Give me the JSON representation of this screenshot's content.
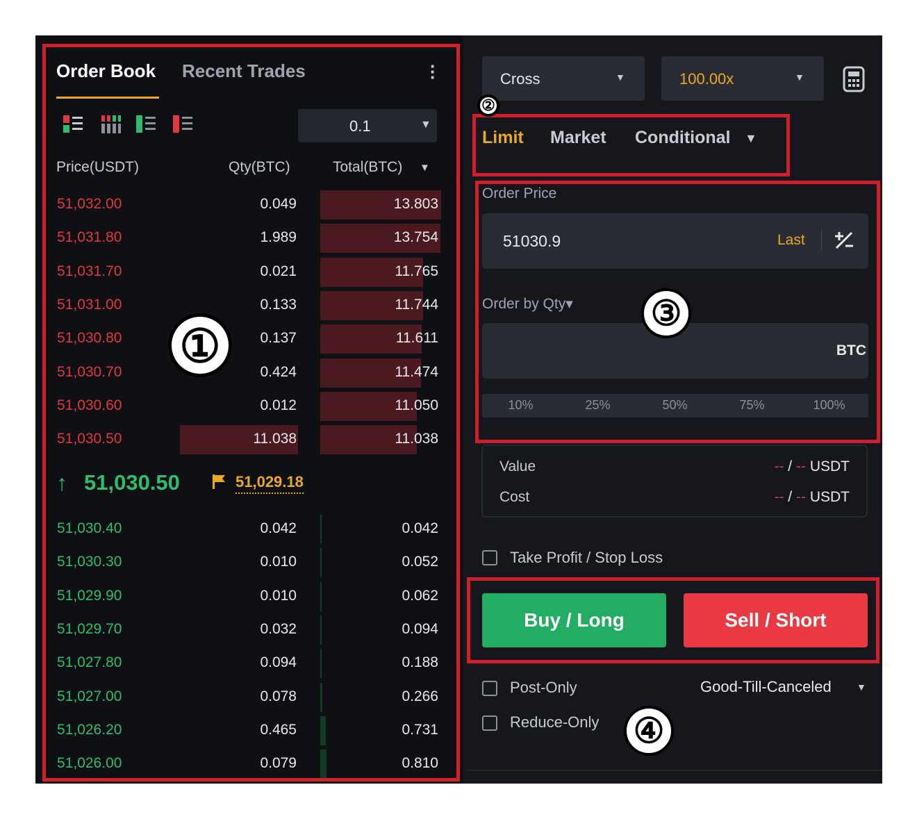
{
  "orderbook": {
    "tabs": [
      "Order Book",
      "Recent Trades"
    ],
    "precision": "0.1",
    "columns": {
      "price": "Price(USDT)",
      "qty": "Qty(BTC)",
      "total": "Total(BTC)"
    },
    "asks": [
      {
        "price": "51,032.00",
        "qty": "0.049",
        "total": "13.803"
      },
      {
        "price": "51,031.80",
        "qty": "1.989",
        "total": "13.754"
      },
      {
        "price": "51,031.70",
        "qty": "0.021",
        "total": "11.765"
      },
      {
        "price": "51,031.00",
        "qty": "0.133",
        "total": "11.744"
      },
      {
        "price": "51,030.80",
        "qty": "0.137",
        "total": "11.611"
      },
      {
        "price": "51,030.70",
        "qty": "0.424",
        "total": "11.474"
      },
      {
        "price": "51,030.60",
        "qty": "0.012",
        "total": "11.050"
      },
      {
        "price": "51,030.50",
        "qty": "11.038",
        "total": "11.038"
      }
    ],
    "last_price": "51,030.50",
    "mark_price": "51,029.18",
    "bids": [
      {
        "price": "51,030.40",
        "qty": "0.042",
        "total": "0.042"
      },
      {
        "price": "51,030.30",
        "qty": "0.010",
        "total": "0.052"
      },
      {
        "price": "51,029.90",
        "qty": "0.010",
        "total": "0.062"
      },
      {
        "price": "51,029.70",
        "qty": "0.032",
        "total": "0.094"
      },
      {
        "price": "51,027.80",
        "qty": "0.094",
        "total": "0.188"
      },
      {
        "price": "51,027.00",
        "qty": "0.078",
        "total": "0.266"
      },
      {
        "price": "51,026.20",
        "qty": "0.465",
        "total": "0.731"
      },
      {
        "price": "51,026.00",
        "qty": "0.079",
        "total": "0.810"
      }
    ]
  },
  "order_form": {
    "margin_mode": "Cross",
    "leverage": "100.00x",
    "order_types": [
      "Limit",
      "Market",
      "Conditional"
    ],
    "order_price_label": "Order Price",
    "order_price_value": "51030.9",
    "last_label": "Last",
    "qty_label": "Order by Qty▾",
    "qty_unit": "BTC",
    "percent_options": [
      "10%",
      "25%",
      "50%",
      "75%",
      "100%"
    ],
    "value_label": "Value",
    "cost_label": "Cost",
    "empty_dash": "--",
    "slash": "/",
    "currency": "USDT",
    "tp_sl_label": "Take Profit / Stop Loss",
    "buy_label": "Buy / Long",
    "sell_label": "Sell / Short",
    "post_only_label": "Post-Only",
    "reduce_only_label": "Reduce-Only",
    "time_in_force": "Good-Till-Canceled"
  },
  "annotations": [
    "①",
    "②",
    "③",
    "④"
  ],
  "colors": {
    "ask": "#e0383e",
    "bid": "#2ebd6c",
    "accent": "#e9a922",
    "buy": "#22ad62",
    "sell": "#ea3943",
    "highlight_box": "#d01f2a"
  }
}
